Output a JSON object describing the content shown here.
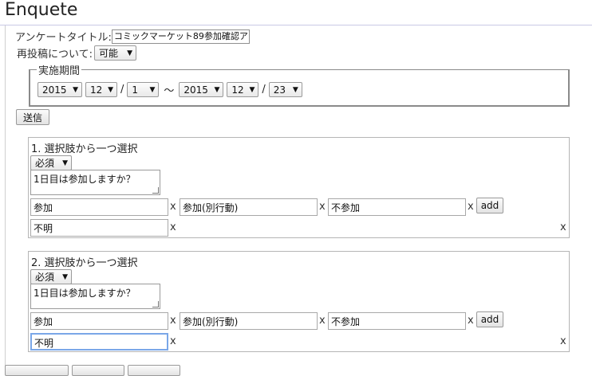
{
  "app": {
    "title": "Enquete"
  },
  "form": {
    "survey_title_label": "アンケートタイトル:",
    "survey_title_value": "コミックマーケット89参加確認ア",
    "repost_label": "再投稿について:",
    "repost_value": "可能",
    "period_legend": "実施期間",
    "start": {
      "year": "2015",
      "month": "12",
      "day": "1"
    },
    "end": {
      "year": "2015",
      "month": "12",
      "day": "23"
    },
    "slash": "/",
    "tilde": "～",
    "submit_label": "送信"
  },
  "questions": [
    {
      "title": "1. 選択肢から一つ選択",
      "required": "必須",
      "text": "1日目は参加しますか？",
      "options": [
        "参加",
        "参加(別行動)",
        "不参加",
        "不明"
      ],
      "add_label": "add",
      "remove_label": "x"
    },
    {
      "title": "2. 選択肢から一つ選択",
      "required": "必須",
      "text": "1日目は参加しますか？",
      "options": [
        "参加",
        "参加(別行動)",
        "不参加",
        "不明"
      ],
      "add_label": "add",
      "remove_label": "x"
    }
  ],
  "bottom_buttons": [
    "",
    "",
    ""
  ]
}
